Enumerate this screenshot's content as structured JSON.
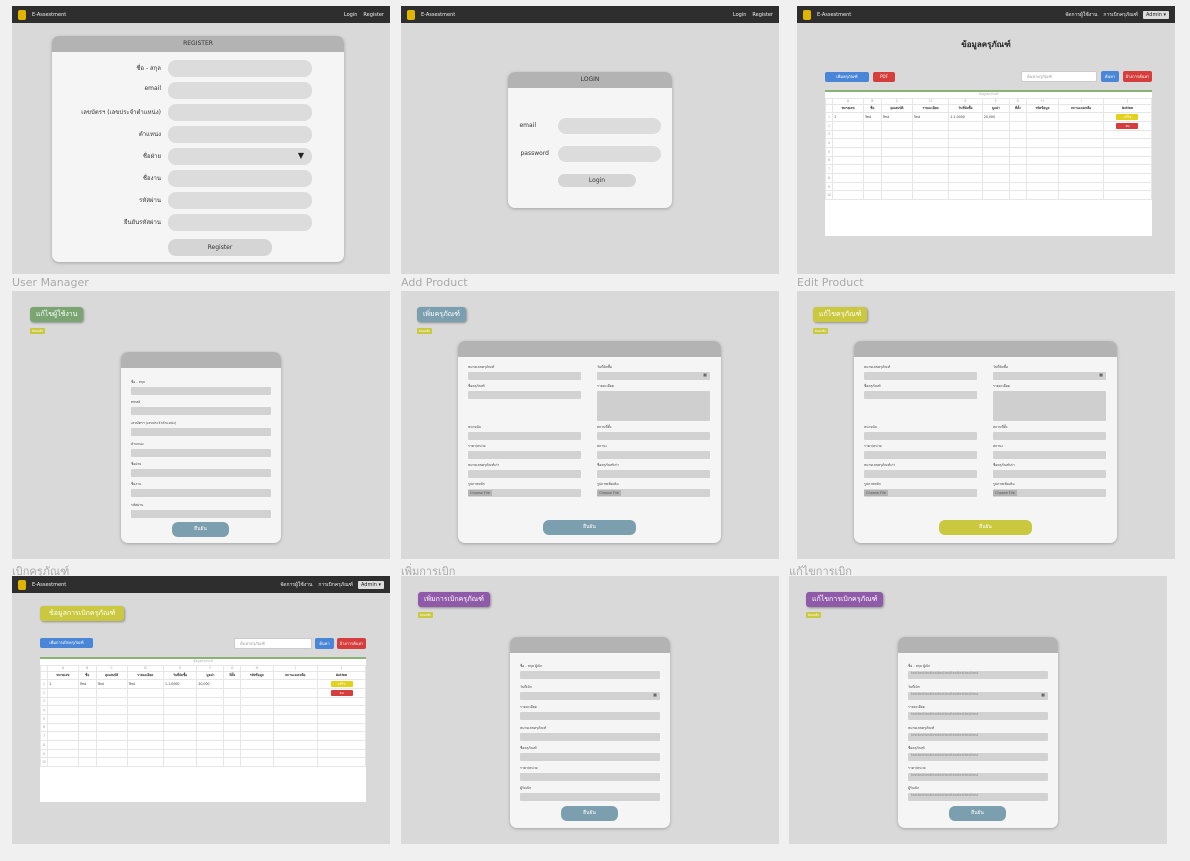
{
  "labels": {
    "user_manager": "User Manager",
    "add_product": "Add Product",
    "edit_product": "Edit Product",
    "borrow": "เบิกครุภัณฑ์",
    "add_borrow": "เพิ่มการเบิก",
    "edit_borrow": "แก้ไขการเบิก"
  },
  "nav": {
    "brand": "E-Assestment",
    "login": "Login",
    "register": "Register",
    "manage_users": "จัดการผู้ใช้งาน",
    "borrow_items": "การเบิกครุภัณฑ์",
    "admin": "Admin ▾"
  },
  "register": {
    "title": "REGISTER",
    "fields": [
      "ชื่อ - สกุล",
      "email",
      "เลขบัตรฯ (เลขประจำตำแหน่ง)",
      "ตำแหน่ง",
      "ชื่อฝ่าย",
      "ชื่องาน",
      "รหัสผ่าน",
      "ยืนยันรหัสผ่าน"
    ],
    "dropdown_arrow": "▼",
    "button": "Register"
  },
  "login": {
    "title": "LOGIN",
    "email": "email",
    "password": "password",
    "button": "Login"
  },
  "products": {
    "title": "ข้อมูลครุภัณฑ์",
    "add_btn": "เพิ่มครุภัณฑ์",
    "pdf_btn": "PDF",
    "search_placeholder": "ค้นหาครุภัณฑ์",
    "search_btn": "ค้นหา",
    "clear_btn": "ล้างการค้นหา",
    "caption": "ข้อมูลครุภัณฑ์",
    "letters": [
      "A",
      "B",
      "C",
      "D",
      "E",
      "F",
      "G",
      "H",
      "I",
      "J"
    ],
    "headers": [
      "หมายเลข",
      "ชื่อ",
      "คุณสมบัติ",
      "รายละเอียด",
      "วันที่จัดซื้อ",
      "มูลค่า",
      "ที่ตั้ง",
      "รหัสข้อมูล",
      "สถานะคงเหลือ",
      "Action"
    ],
    "row": [
      "1",
      "Test",
      "Test",
      "Test",
      "1-1-0000",
      "20,000"
    ],
    "row_numbers": [
      "1",
      "2",
      "3",
      "4",
      "5",
      "6",
      "7",
      "8",
      "9",
      "10"
    ],
    "edit": "แก้ไข",
    "delete": "ลบ"
  },
  "user_edit": {
    "title": "แก้ไขผู้ใช้งาน",
    "back": "ย้อนกลับ",
    "fields": [
      "ชื่อ - สกุล",
      "email",
      "เลขบัตรฯ (เลขประจำตำแหน่ง)",
      "ตำแหน่ง",
      "ชื่อฝ่าย",
      "ชื่องาน",
      "รหัสผ่าน"
    ],
    "button": "ยืนยัน"
  },
  "add_product": {
    "title": "เพิ่มครุภัณฑ์",
    "back": "ย้อนกลับ",
    "labels": [
      "หมายเลขครุภัณฑ์",
      "วันที่จัดซื้อ",
      "ชื่อครุภัณฑ์",
      "รายละเอียด",
      "หน่วยนับ",
      "สถานที่ตั้ง",
      "ราคา/หน่วย",
      "สถานะ",
      "หมายเลขครุภัณฑ์เก่า",
      "ชื่อครุภัณฑ์เก่า",
      "รูปภาพหลัก",
      "รูปภาพเพิ่มเติม"
    ],
    "file_btn": "Choose File",
    "button": "ยืนยัน"
  },
  "edit_product": {
    "title": "แก้ไขครุภัณฑ์",
    "back": "ย้อนกลับ",
    "button": "ยืนยัน"
  },
  "borrow": {
    "title": "ข้อมูลการเบิกครุภัณฑ์",
    "add_btn": "เพิ่มการเบิกครุภัณฑ์",
    "search_placeholder": "ค้นหาครุภัณฑ์"
  },
  "add_borrow": {
    "title": "เพิ่มการเบิกครุภัณฑ์",
    "back": "ย้อนกลับ",
    "labels": [
      "ชื่อ - สกุล ผู้เบิก",
      "วันที่เบิก",
      "รายละเอียด",
      "หมายเลขครุภัณฑ์",
      "ชื่อครุภัณฑ์",
      "ราคา/หน่วย",
      "ผู้รับเบิก"
    ],
    "button": "ยืนยัน"
  },
  "edit_borrow": {
    "title": "แก้ไขการเบิกครุภัณฑ์",
    "back": "ย้อนกลับ",
    "labels": [
      "ชื่อ - สกุล ผู้เบิก",
      "วันที่เบิก",
      "รายละเอียด",
      "หมายเลขครุภัณฑ์",
      "ชื่อครุภัณฑ์",
      "ราคา/หน่วย",
      "ผู้รับเบิก"
    ],
    "value": "testtesttesttesttesttesttesttesttesttest",
    "button": "ยืนยัน"
  },
  "colors": {
    "green": "#7aa472",
    "teal": "#7b9fae",
    "olive": "#c9c83e",
    "purple": "#8f5aa8",
    "blue": "#4a86d8",
    "red": "#d63e3e",
    "yellow": "#e3d21c"
  },
  "icons": {
    "logo": "database-icon",
    "calendar": "calendar-icon"
  }
}
